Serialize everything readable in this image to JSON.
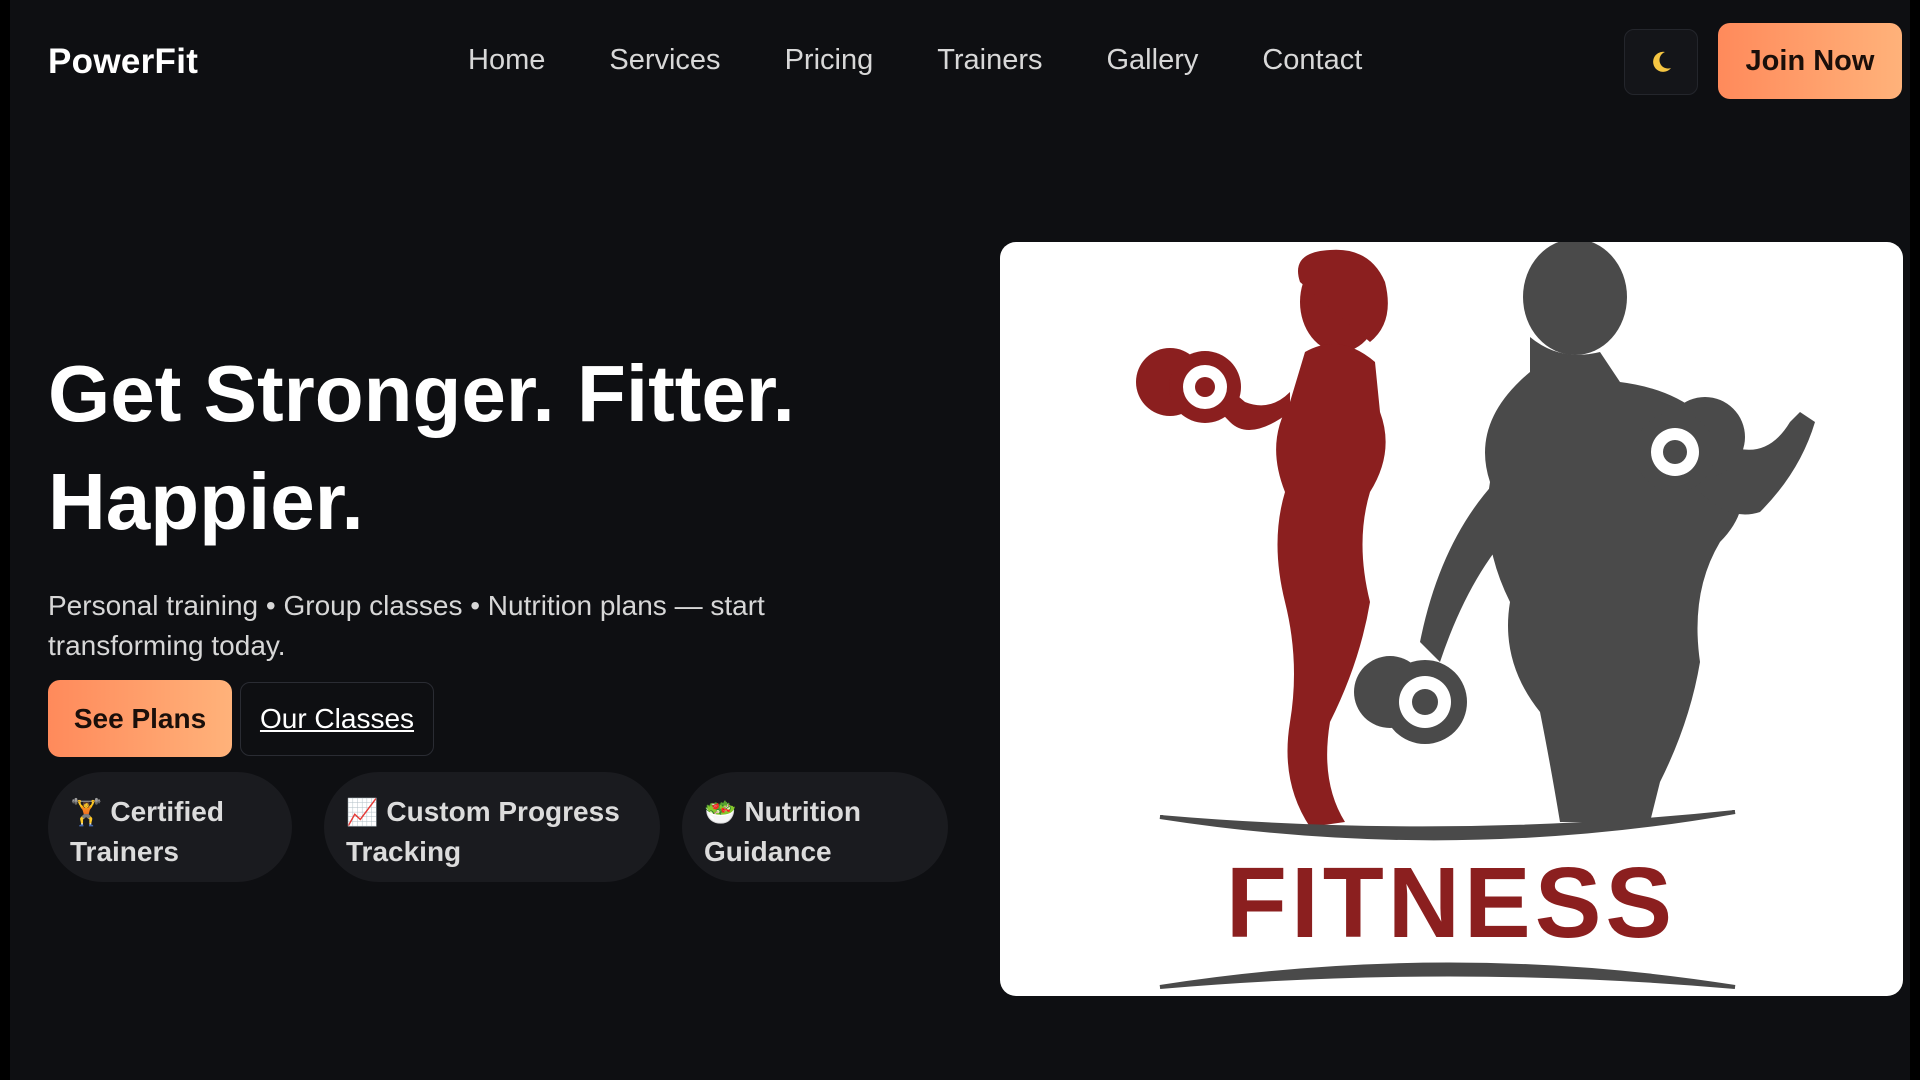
{
  "nav": {
    "brand": "PowerFit",
    "links": [
      "Home",
      "Services",
      "Pricing",
      "Trainers",
      "Gallery",
      "Contact"
    ],
    "theme_icon": "moon-icon",
    "join_label": "Join Now"
  },
  "hero": {
    "title_line1": "Get Stronger. Fitter.",
    "title_line2": "Happier.",
    "subtitle": "Personal training • Group classes • Nutrition plans — start transforming today.",
    "primary_button": "See Plans",
    "secondary_button": "Our Classes",
    "features": [
      {
        "icon": "🏋",
        "label": "Certified Trainers"
      },
      {
        "icon": "📈",
        "label": "Custom Progress Tracking"
      },
      {
        "icon": "🥗",
        "label": "Nutrition Guidance"
      }
    ]
  },
  "image": {
    "logo_text": "FITNESS"
  },
  "colors": {
    "background": "#0e0f12",
    "accent_start": "#ff8a5b",
    "accent_end": "#ffb27a",
    "logo_red": "#8b1f1f",
    "logo_gray": "#4a4a4a"
  }
}
